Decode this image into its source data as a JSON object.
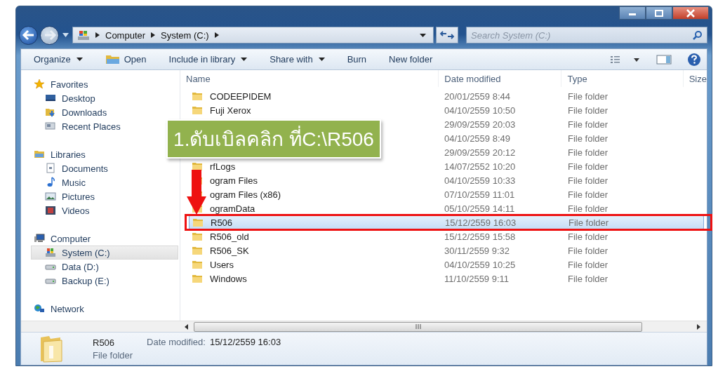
{
  "navigation": {
    "breadcrumb": [
      "Computer",
      "System (C:)"
    ],
    "search": {
      "placeholder": "Search System (C:)"
    }
  },
  "toolbar": [
    {
      "label": "Organize",
      "kind": "menu"
    },
    {
      "label": "Open",
      "kind": "open"
    },
    {
      "label": "Include in library",
      "kind": "menu"
    },
    {
      "label": "Share with",
      "kind": "menu"
    },
    {
      "label": "Burn",
      "kind": "plain"
    },
    {
      "label": "New folder",
      "kind": "plain"
    }
  ],
  "sidebar": [
    {
      "label": "Favorites",
      "kind": "star",
      "selected": false,
      "children": [
        {
          "label": "Desktop",
          "kind": "desktop",
          "selected": false
        },
        {
          "label": "Downloads",
          "kind": "downloads",
          "selected": false
        },
        {
          "label": "Recent Places",
          "kind": "recent",
          "selected": false
        }
      ]
    },
    {
      "label": "Libraries",
      "kind": "library",
      "selected": false,
      "children": [
        {
          "label": "Documents",
          "kind": "document",
          "selected": false
        },
        {
          "label": "Music",
          "kind": "music",
          "selected": false
        },
        {
          "label": "Pictures",
          "kind": "pictures",
          "selected": false
        },
        {
          "label": "Videos",
          "kind": "videos",
          "selected": false
        }
      ]
    },
    {
      "label": "Computer",
      "kind": "computer",
      "selected": false,
      "children": [
        {
          "label": "System (C:)",
          "kind": "system-drive",
          "selected": true
        },
        {
          "label": "Data (D:)",
          "kind": "drive",
          "selected": false
        },
        {
          "label": "Backup (E:)",
          "kind": "drive",
          "selected": false
        }
      ]
    },
    {
      "label": "Network",
      "kind": "network",
      "selected": false
    }
  ],
  "table": {
    "columns": [
      "Name",
      "Date modified",
      "Type",
      "Size"
    ],
    "rows": [
      {
        "name": "CODEEPIDEM",
        "date": "20/01/2559 8:44",
        "type": "File folder",
        "selected": false
      },
      {
        "name": "Fuji Xerox",
        "date": "04/10/2559 10:50",
        "type": "File folder",
        "selected": false
      },
      {
        "date": "29/09/2559 20:03",
        "type": "File folder",
        "selected": false
      },
      {
        "date": "04/10/2559 8:49",
        "type": "File folder",
        "selected": false
      },
      {
        "date": "29/09/2559 20:12",
        "type": "File folder",
        "selected": false
      },
      {
        "name": "rfLogs",
        "date": "14/07/2552 10:20",
        "type": "File folder",
        "selected": false
      },
      {
        "name": "ogram Files",
        "date": "04/10/2559 10:33",
        "type": "File folder",
        "selected": false
      },
      {
        "name": "ogram Files (x86)",
        "date": "07/10/2559 11:01",
        "type": "File folder",
        "selected": false
      },
      {
        "name": "ogramData",
        "date": "05/10/2559 14:11",
        "type": "File folder",
        "selected": false
      },
      {
        "name": "R506",
        "date": "15/12/2559 16:03",
        "type": "File folder",
        "selected": true
      },
      {
        "name": "R506_old",
        "date": "15/12/2559 15:58",
        "type": "File folder",
        "selected": false
      },
      {
        "name": "R506_SK",
        "date": "30/11/2559 9:32",
        "type": "File folder",
        "selected": false
      },
      {
        "name": "Users",
        "date": "04/10/2559 10:25",
        "type": "File folder",
        "selected": false
      },
      {
        "name": "Windows",
        "date": "11/10/2559 9:11",
        "type": "File folder",
        "selected": false
      }
    ]
  },
  "details": {
    "name": "R506",
    "type": "File folder",
    "date_label": "Date modified:",
    "date": "15/12/2559 16:03"
  },
  "annotation": {
    "text": "1.ดับเบิลคลิก ที่C:\\R506"
  }
}
